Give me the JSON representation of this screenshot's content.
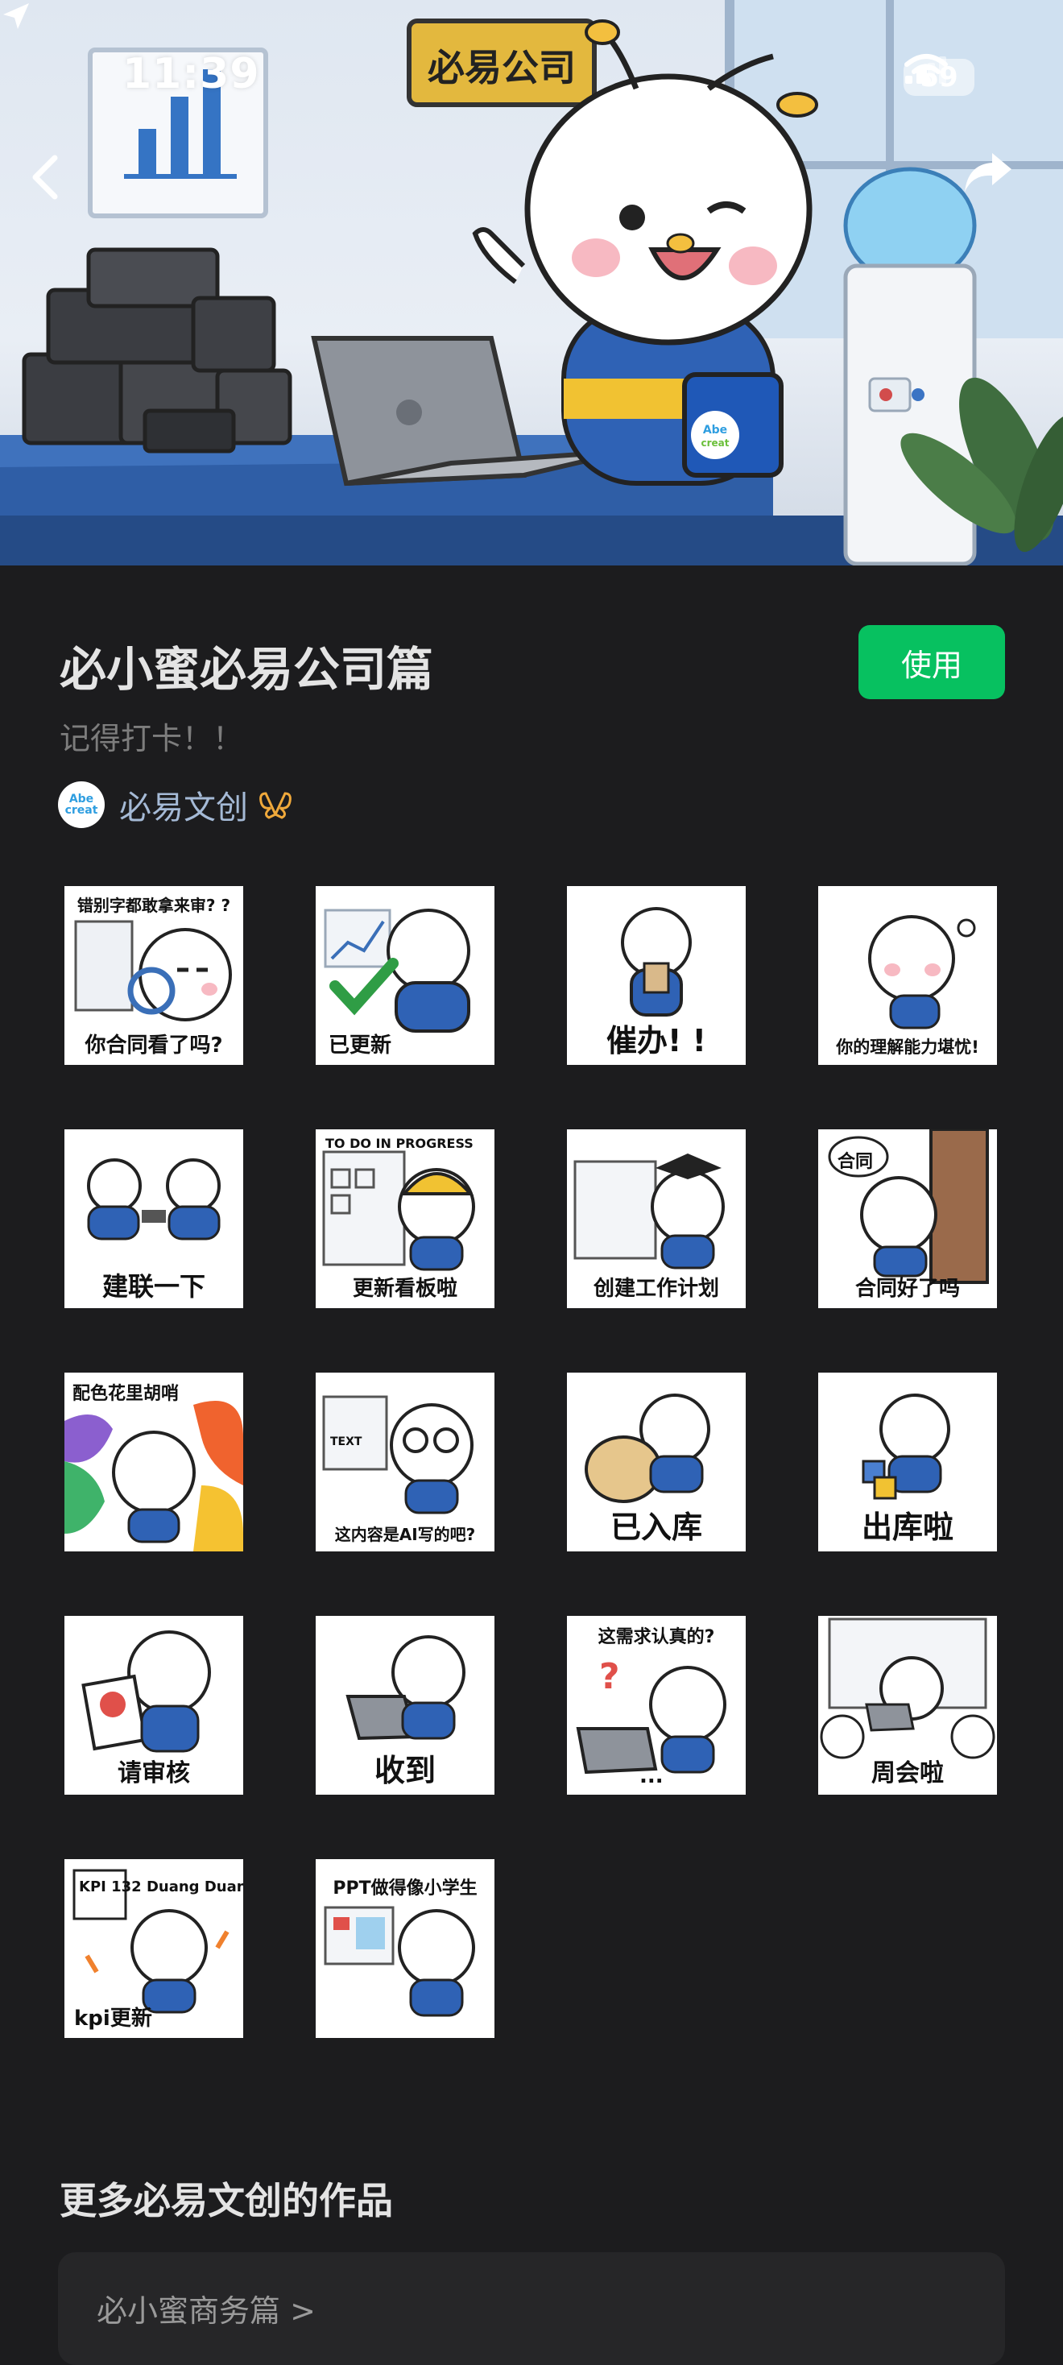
{
  "status_bar": {
    "time": "11:39",
    "battery": "59"
  },
  "hero": {
    "sign_text": "必易公司",
    "mug_text": "Abe creat"
  },
  "header": {
    "title": "必小蜜必易公司篇",
    "subtitle": "记得打卡！！",
    "use_button": "使用"
  },
  "author": {
    "name": "必易文创",
    "avatar_text": "Abe creat"
  },
  "stickers": [
    {
      "caption": "你合同看了吗?",
      "top_text": "错别字都敢拿来审? ?"
    },
    {
      "caption": "已更新"
    },
    {
      "caption": "催办! !"
    },
    {
      "caption": "你的理解能力堪忧!"
    },
    {
      "caption": "建联一下"
    },
    {
      "caption": "更新看板啦",
      "top_text": "TO DO    IN PROGRESS"
    },
    {
      "caption": "创建工作计划"
    },
    {
      "caption": "合同好了吗",
      "top_text": "合同"
    },
    {
      "caption": "",
      "top_text": "配色花里胡哨"
    },
    {
      "caption": "这内容是AI写的吧?",
      "top_text": "TEXT"
    },
    {
      "caption": "已入库"
    },
    {
      "caption": "出库啦"
    },
    {
      "caption": "请审核"
    },
    {
      "caption": "收到"
    },
    {
      "caption": "...",
      "top_text": "这需求认真的?"
    },
    {
      "caption": "周会啦"
    },
    {
      "caption": "kpi更新",
      "top_text": "KPI 132  Duang Duang"
    },
    {
      "caption": "",
      "top_text": "PPT做得像小学生"
    }
  ],
  "more": {
    "heading": "更多必易文创的作品",
    "card_title": "必小蜜商务篇 >"
  },
  "colors": {
    "accent_green": "#07c160",
    "background": "#1c1c1e",
    "author_link": "#a5bad6"
  }
}
